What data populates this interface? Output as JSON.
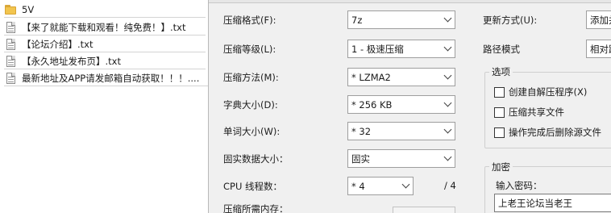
{
  "file_list": {
    "items": [
      {
        "name": "5V",
        "type": "folder"
      },
      {
        "name": "【来了就能下载和观看！纯免费！】.txt",
        "type": "file"
      },
      {
        "name": "【论坛介绍】.txt",
        "type": "file"
      },
      {
        "name": "【永久地址发布页】.txt",
        "type": "file"
      },
      {
        "name": "最新地址及APP请发邮箱自动获取！！！....",
        "type": "file"
      }
    ]
  },
  "compression": {
    "format": {
      "label": "压缩格式(F):",
      "value": "7z"
    },
    "level": {
      "label": "压缩等级(L):",
      "value": "1 - 极速压缩"
    },
    "method": {
      "label": "压缩方法(M):",
      "value": "* LZMA2"
    },
    "dict_size": {
      "label": "字典大小(D):",
      "value": "* 256 KB"
    },
    "word_size": {
      "label": "单词大小(W):",
      "value": "* 32"
    },
    "solid_block": {
      "label": "固实数据大小：",
      "value": "固实"
    },
    "cpu_threads": {
      "label": "CPU 线程数：",
      "value": "* 4",
      "max": "/ 4"
    },
    "memory_label": "压缩所需内存："
  },
  "update": {
    "mode_label": "更新方式(U):",
    "mode_value": "添加并",
    "path_label": "路径模式",
    "path_value": "相对路"
  },
  "options": {
    "title": "选项",
    "items": [
      {
        "label": "创建自解压程序(X)",
        "checked": false
      },
      {
        "label": "压缩共享文件",
        "checked": false
      },
      {
        "label": "操作完成后删除源文件",
        "checked": false
      }
    ]
  },
  "encryption": {
    "title": "加密",
    "password_label": "输入密码：",
    "password_value": "上老王论坛当老王"
  }
}
